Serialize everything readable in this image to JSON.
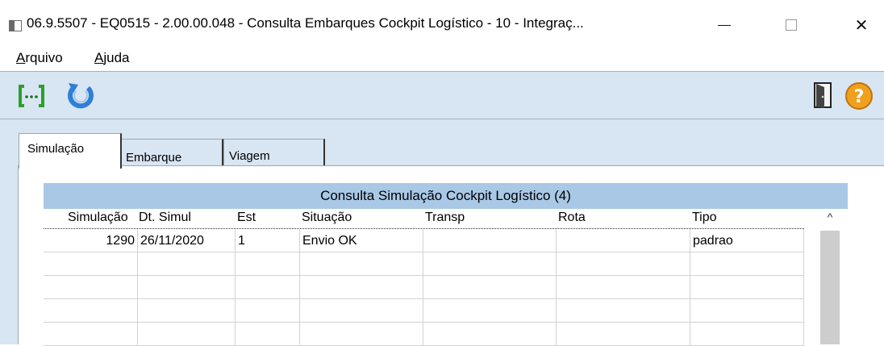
{
  "window": {
    "title": "06.9.5507 - EQ0515 - 2.00.00.048 - Consulta Embarques Cockpit Logístico - 10 - Integraç...",
    "close_glyph": "✕"
  },
  "menu": {
    "arquivo_first": "A",
    "arquivo_rest": "rquivo",
    "ajuda_first": "A",
    "ajuda_rest": "juda"
  },
  "toolbar": {
    "zoom_icon": "zoom-bracket-icon",
    "refresh_icon": "refresh-icon",
    "exit_icon": "exit-door-icon",
    "help_icon": "help-icon",
    "help_glyph": "?",
    "zoom_glyph": "[···]"
  },
  "tabs": [
    {
      "label": "Simulação",
      "active": true
    },
    {
      "label": "Embarque",
      "active": false
    },
    {
      "label": "Viagem",
      "active": false
    }
  ],
  "grid": {
    "title": "Consulta Simulação Cockpit Logístico (4)",
    "columns": [
      "Simulação",
      "Dt. Simul",
      "Est",
      "Situação",
      "Transp",
      "Rota",
      "Tipo"
    ],
    "rows": [
      [
        "1290",
        "26/11/2020",
        "1",
        "Envio OK",
        "",
        "",
        "padrao"
      ],
      [
        "",
        "",
        "",
        "",
        "",
        "",
        ""
      ],
      [
        "",
        "",
        "",
        "",
        "",
        "",
        ""
      ],
      [
        "",
        "",
        "",
        "",
        "",
        "",
        ""
      ],
      [
        "",
        "",
        "",
        "",
        "",
        "",
        ""
      ]
    ],
    "scroll_up_glyph": "^"
  },
  "colors": {
    "toolbar_bg": "#d8e5f2",
    "grid_title_bg": "#a9c8e6",
    "help_orange": "#f0a01e",
    "refresh_blue": "#2f7fd6",
    "zoom_green": "#2aa02a"
  }
}
